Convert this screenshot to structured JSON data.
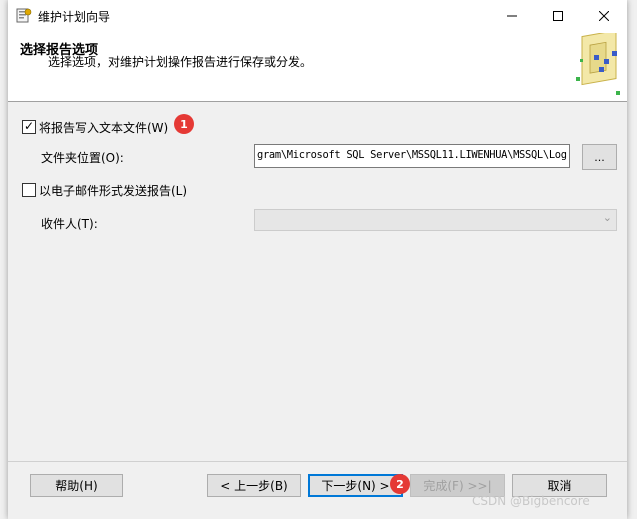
{
  "window": {
    "title": "维护计划向导"
  },
  "header": {
    "title": "选择报告选项",
    "subtitle": "选择选项，对维护计划操作报告进行保存或分发。"
  },
  "options": {
    "write_text_file": {
      "label": "将报告写入文本文件(W)",
      "checked": true
    },
    "folder_label": "文件夹位置(O):",
    "folder_value": "gram\\Microsoft SQL Server\\MSSQL11.LIWENHUA\\MSSQL\\Log",
    "browse_label": "...",
    "email_report": {
      "label": "以电子邮件形式发送报告(L)",
      "checked": false
    },
    "recipient_label": "收件人(T):",
    "recipient_value": ""
  },
  "buttons": {
    "help": "帮助(H)",
    "back": "< 上一步(B)",
    "next": "下一步(N) >",
    "finish": "完成(F) >>|",
    "cancel": "取消"
  },
  "annotations": {
    "badge1": "1",
    "badge2": "2"
  },
  "watermark": "CSDN @Bigbencore",
  "colors": {
    "badge": "#e53935",
    "primary_border": "#0078d7"
  }
}
